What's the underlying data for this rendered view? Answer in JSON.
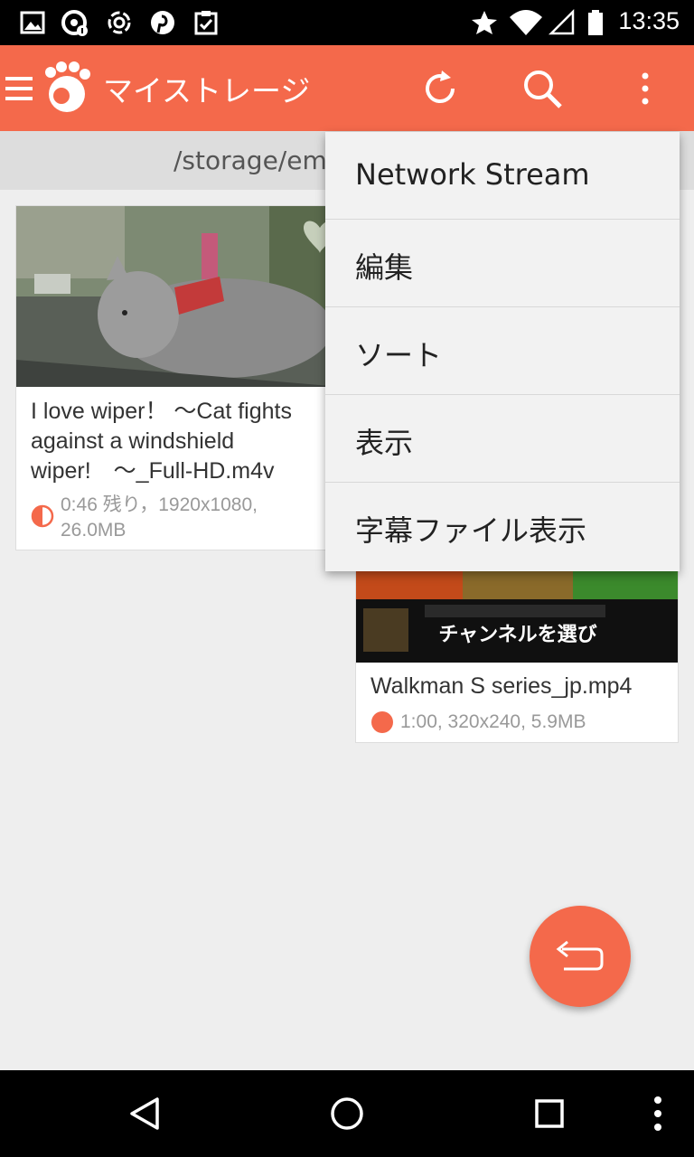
{
  "status_bar": {
    "time": "13:35",
    "left_icons": [
      "image-icon",
      "info-circle-icon",
      "swirl-icon",
      "pinterest-icon",
      "clipboard-check-icon"
    ],
    "right_icons": [
      "star-icon",
      "wifi-icon",
      "signal-icon",
      "battery-icon"
    ]
  },
  "toolbar": {
    "title": "マイストレージ",
    "accent_color": "#f4694b",
    "icons": [
      "menu-icon",
      "app-logo-icon",
      "refresh-icon",
      "search-icon",
      "overflow-menu-icon"
    ]
  },
  "path_bar": {
    "text": "/storage/emu"
  },
  "cards": [
    {
      "name": "I love wiper！ 〜Cat fights against a windshield wiper!　〜_Full-HD.m4v",
      "name_lines": [
        "I love wiper！ 〜Cat fights",
        "against a windshield",
        "wiper!　〜_Full-HD.m4v"
      ],
      "meta_lines": [
        "0:46 残り，1920x1080,",
        "26.0MB"
      ],
      "status": "partially-watched",
      "favorite_icon": "heart-icon"
    },
    {
      "name": "Walkman S series_jp.mp4",
      "meta_lines": [
        "1:00, 320x240, 5.9MB"
      ],
      "status": "unwatched",
      "thumbnail_caption": "チャンネルを選び"
    }
  ],
  "overflow_menu": {
    "items": [
      {
        "label": "Network Stream"
      },
      {
        "label": "編集"
      },
      {
        "label": "ソート"
      },
      {
        "label": "表示"
      },
      {
        "label": "字幕ファイル表示"
      }
    ]
  },
  "fab": {
    "icon": "return-icon"
  },
  "nav_bar": {
    "icons": [
      "back-icon",
      "home-icon",
      "recents-icon",
      "more-icon"
    ]
  }
}
